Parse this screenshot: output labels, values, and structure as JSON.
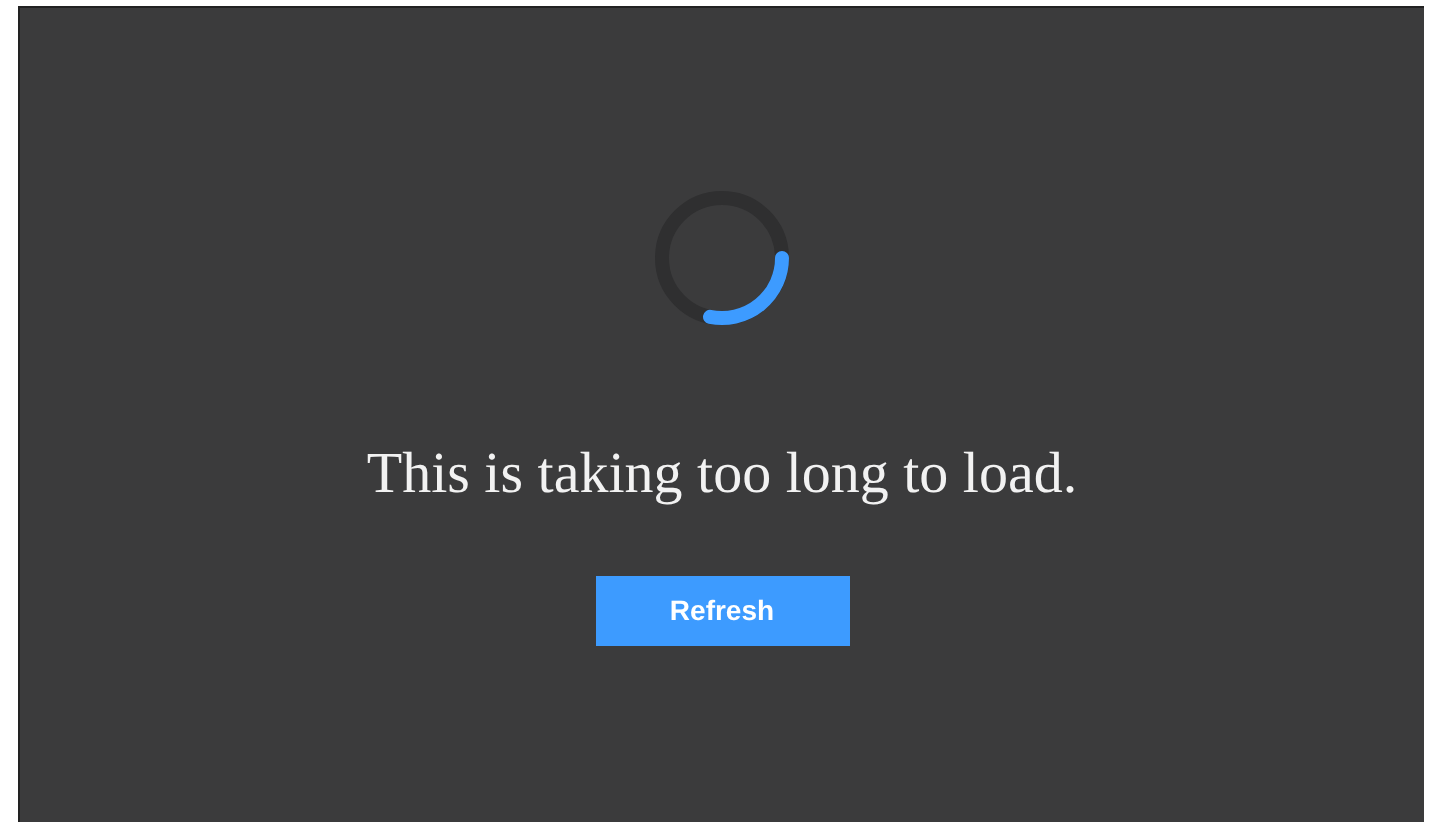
{
  "message": "This is taking too long to load.",
  "button": {
    "label": "Refresh"
  }
}
